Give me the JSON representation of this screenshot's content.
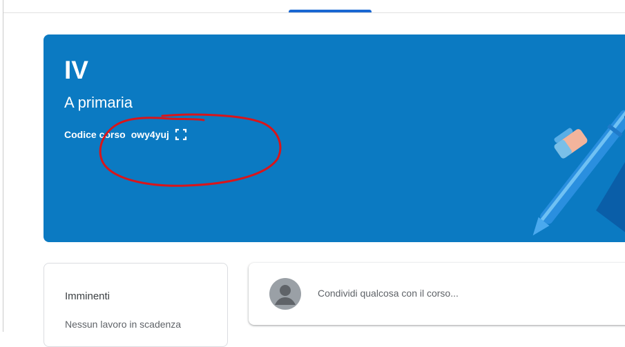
{
  "course": {
    "title": "IV",
    "subtitle": "A primaria",
    "code_label": "Codice corso",
    "code_value": "owy4yuj",
    "banner_color": "#0b7ac2"
  },
  "icons": {
    "expand": "fullscreen-icon",
    "avatar": "person-icon"
  },
  "upcoming": {
    "title": "Imminenti",
    "empty_text": "Nessun lavoro in scadenza"
  },
  "stream": {
    "share_placeholder": "Condividi qualcosa con il corso..."
  },
  "colors": {
    "tab_indicator": "#1967d2",
    "annotation": "#d9151a"
  }
}
